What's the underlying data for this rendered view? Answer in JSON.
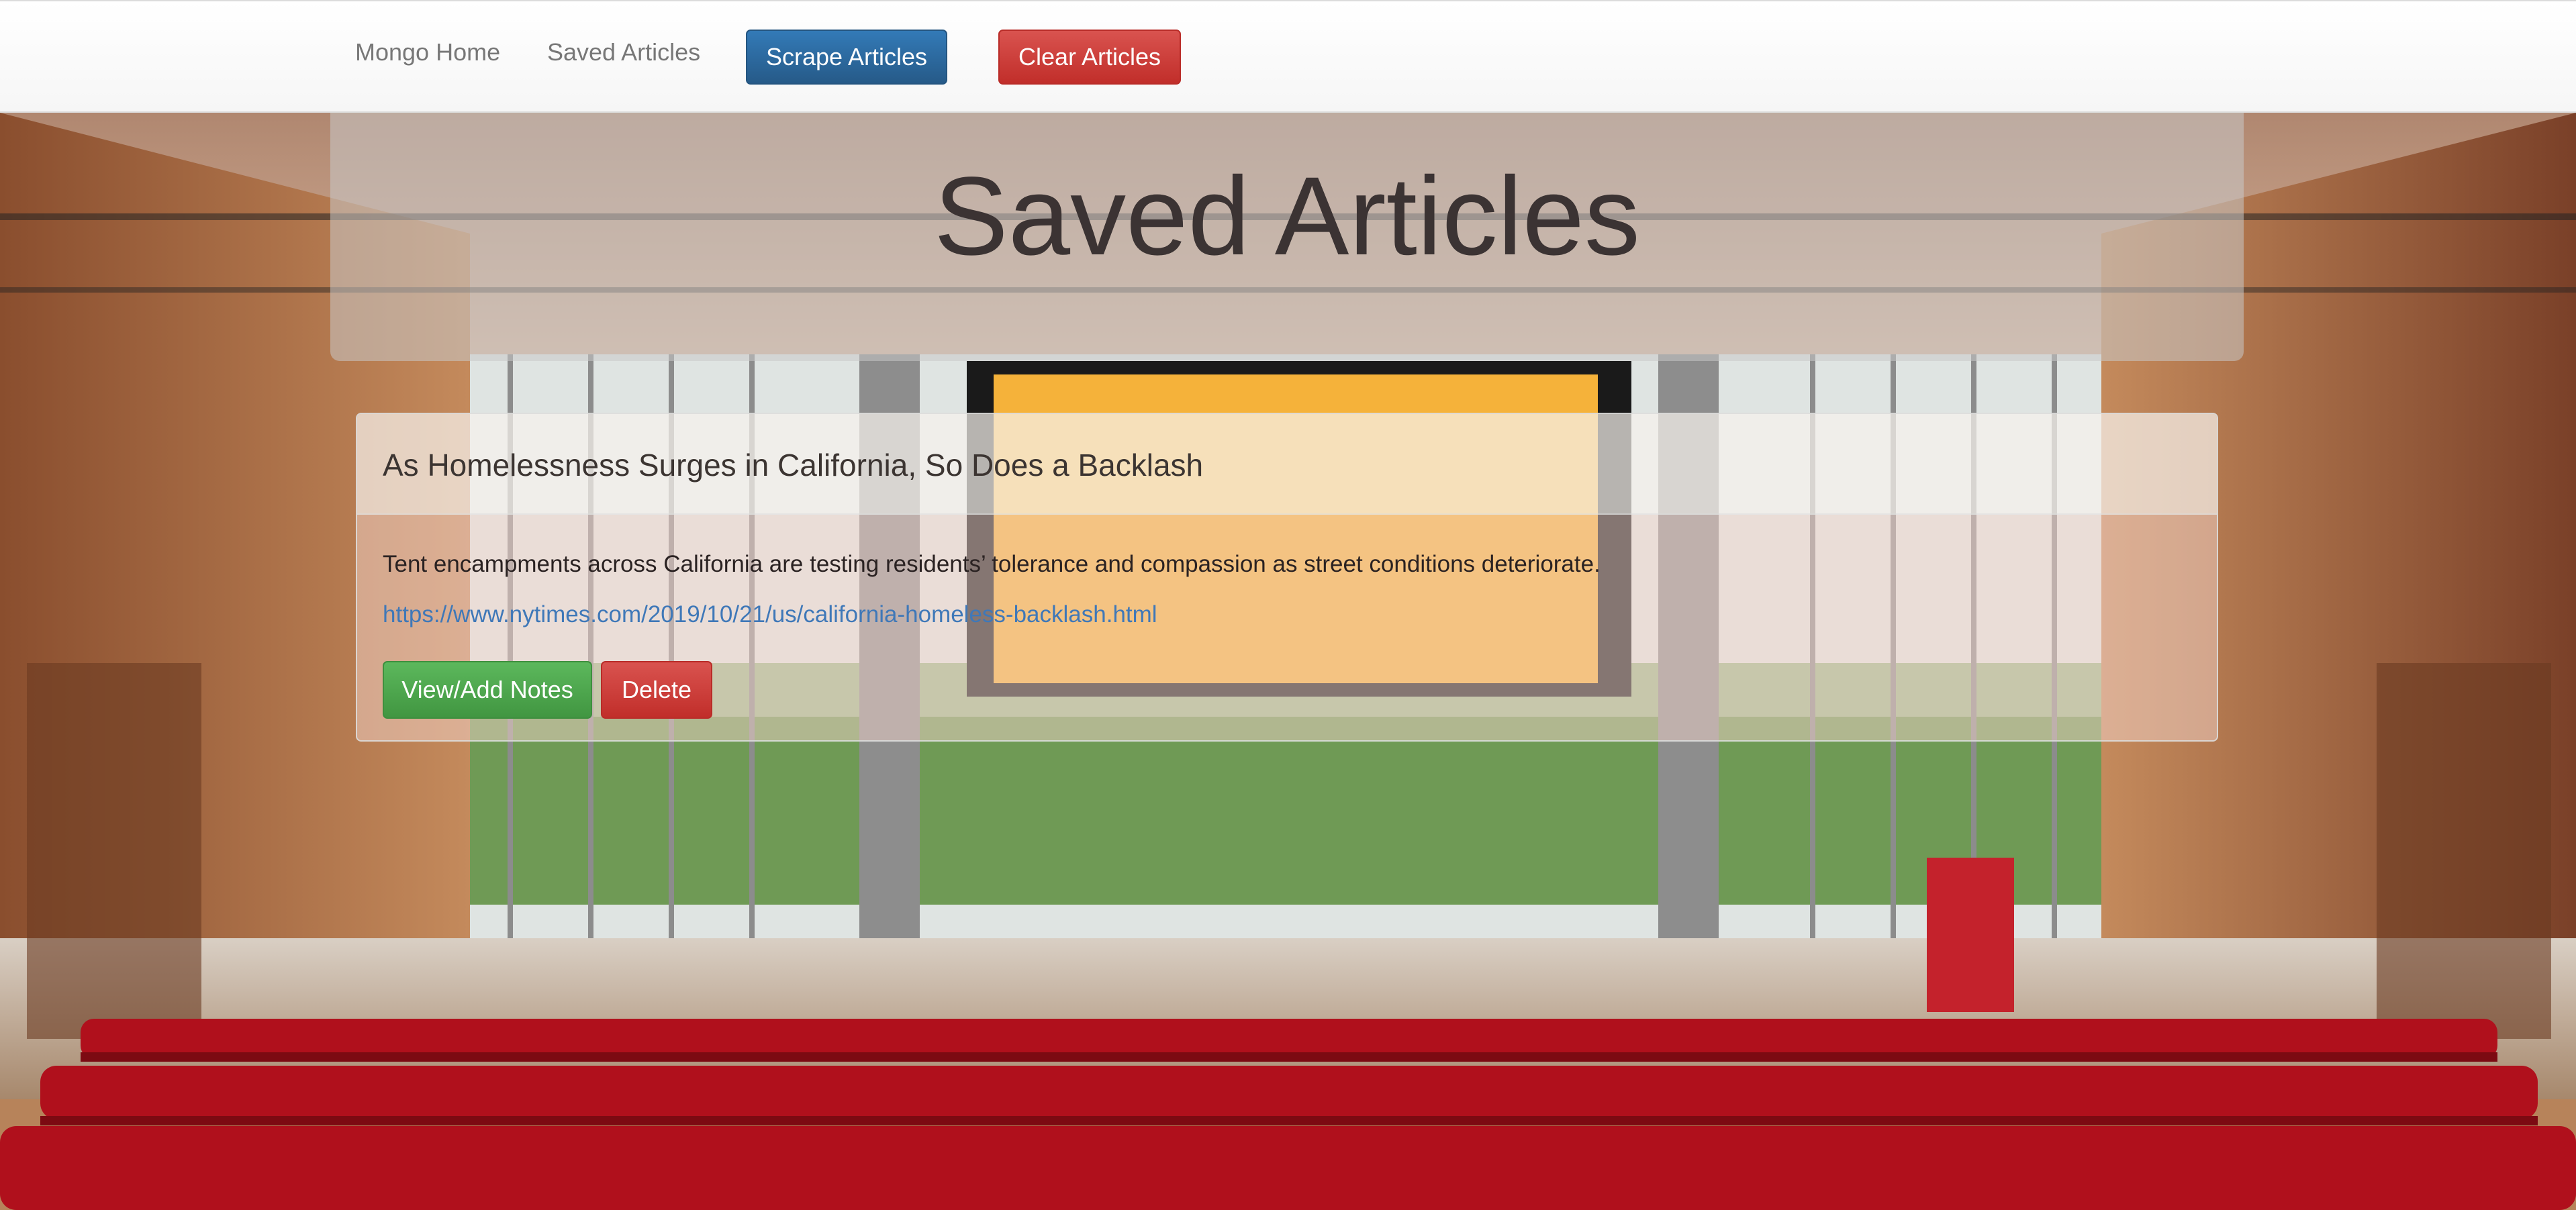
{
  "navbar": {
    "links": [
      {
        "label": "Mongo Home"
      },
      {
        "label": "Saved Articles"
      }
    ],
    "scrape_label": "Scrape Articles",
    "clear_label": "Clear Articles"
  },
  "jumbotron": {
    "title": "Saved Articles"
  },
  "articles": [
    {
      "title": "As Homelessness Surges in California, So Does a Backlash",
      "summary": "Tent encampments across California are testing residents’ tolerance and compassion as street conditions deteriorate.",
      "link": "https://www.nytimes.com/2019/10/21/us/california-homeless-backlash.html",
      "notes_label": "View/Add Notes",
      "delete_label": "Delete"
    }
  ],
  "colors": {
    "primary": "#337ab7",
    "danger": "#d9534f",
    "success": "#5cb85c",
    "link": "#3f78b8"
  }
}
